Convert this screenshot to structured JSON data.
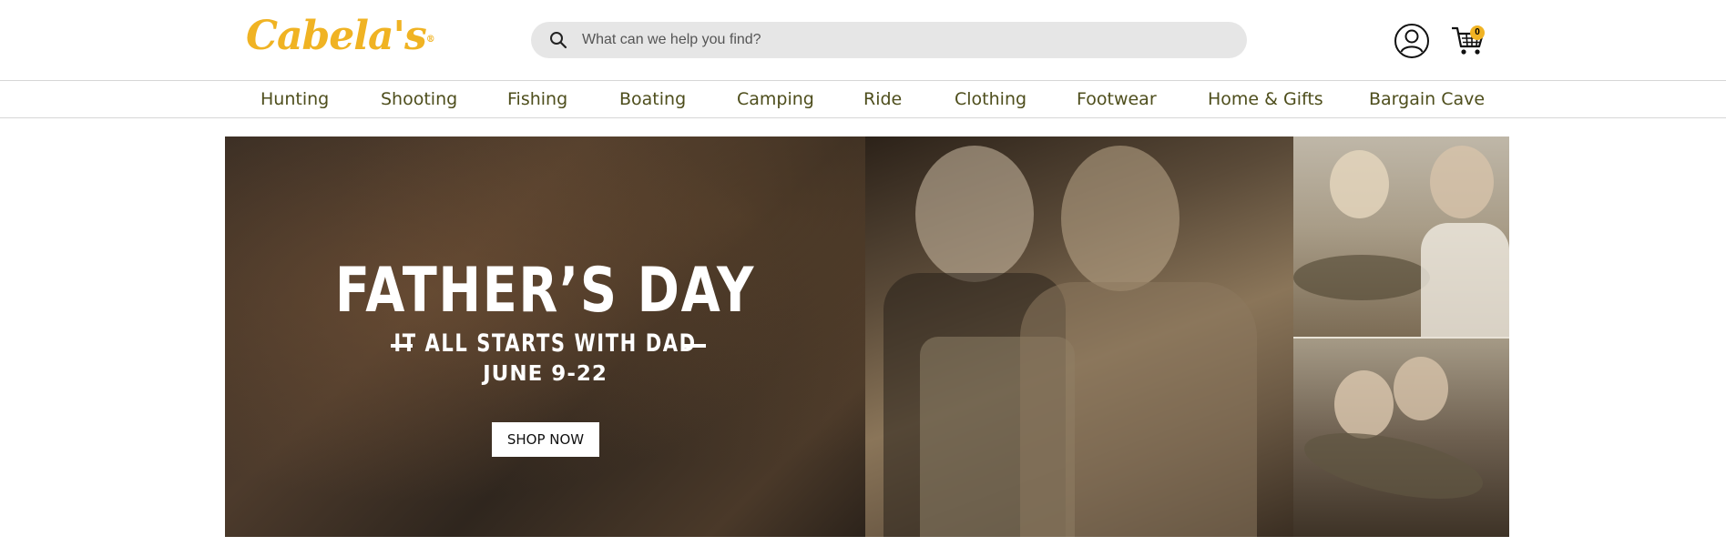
{
  "header": {
    "logo_text": "Cabela's",
    "logo_reg": "®",
    "search_placeholder": "What can we help you find?",
    "cart_count": "0",
    "icons": [
      "search-icon",
      "account-icon",
      "cart-icon"
    ]
  },
  "nav": {
    "items": [
      "Hunting",
      "Shooting",
      "Fishing",
      "Boating",
      "Camping",
      "Ride",
      "Clothing",
      "Footwear",
      "Home & Gifts",
      "Bargain Cave"
    ]
  },
  "hero": {
    "title": "FATHER’S DAY",
    "subtitle": "IT ALL STARTS WITH DAD",
    "dates": "JUNE 9-22",
    "cta": "SHOP NOW"
  },
  "colors": {
    "brand_gold": "#f0b323",
    "nav_text": "#4e4e1c",
    "search_bg": "#e6e6e6"
  }
}
